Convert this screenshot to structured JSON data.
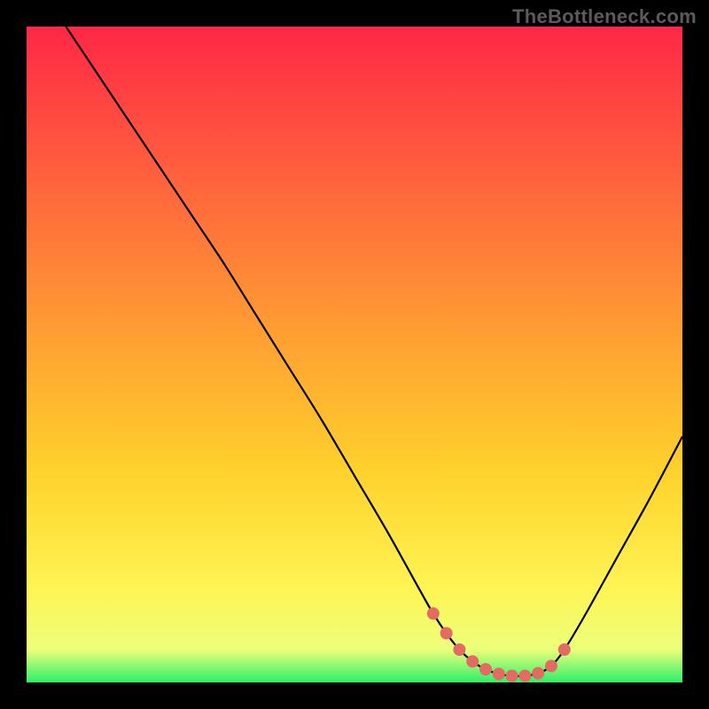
{
  "watermark": "TheBottleneck.com",
  "chart_data": {
    "type": "line",
    "title": "",
    "xlabel": "",
    "ylabel": "",
    "xlim": [
      0,
      100
    ],
    "ylim": [
      0,
      100
    ],
    "grid": false,
    "gradient": {
      "stops": [
        {
          "offset": 0,
          "color": "#ff2746"
        },
        {
          "offset": 0.2,
          "color": "#ff5a3e"
        },
        {
          "offset": 0.45,
          "color": "#ff9a33"
        },
        {
          "offset": 0.68,
          "color": "#ffd22c"
        },
        {
          "offset": 0.86,
          "color": "#fff555"
        },
        {
          "offset": 0.95,
          "color": "#ecff7a"
        },
        {
          "offset": 1.0,
          "color": "#2df06a"
        }
      ]
    },
    "series": [
      {
        "name": "bottleneck-curve",
        "color": "#000000",
        "x": [
          6,
          10,
          15,
          20,
          25,
          30,
          35,
          40,
          45,
          50,
          55,
          60,
          62,
          64,
          66,
          68,
          70,
          72,
          74,
          76,
          78,
          80,
          82,
          85,
          90,
          95,
          100
        ],
        "y": [
          100,
          94,
          86.5,
          79,
          71.5,
          64,
          56,
          48,
          40,
          31.5,
          23,
          14,
          10.5,
          7.5,
          5,
          3.2,
          2.0,
          1.3,
          1.0,
          1.0,
          1.4,
          2.5,
          5,
          10,
          19,
          28,
          37.5
        ]
      }
    ],
    "points": {
      "name": "highlight-dots",
      "color": "#e46a63",
      "radius_px": 7,
      "x": [
        62,
        64,
        66,
        68,
        70,
        72,
        74,
        76,
        78,
        80,
        82
      ],
      "y": [
        10.5,
        7.5,
        5,
        3.2,
        2.0,
        1.3,
        1.0,
        1.0,
        1.4,
        2.5,
        5
      ]
    }
  }
}
